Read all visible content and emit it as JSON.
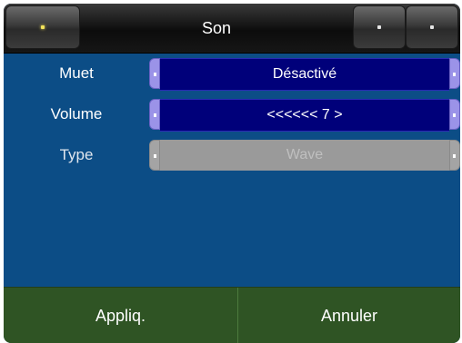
{
  "header": {
    "title": "Son"
  },
  "settings": [
    {
      "label": "Muet",
      "value": "Désactivé",
      "state": "active"
    },
    {
      "label": "Volume",
      "value": "<<<<<< 7 >",
      "state": "active"
    },
    {
      "label": "Type",
      "value": "Wave",
      "state": "disabled"
    }
  ],
  "footer": {
    "apply_label": "Appliq.",
    "cancel_label": "Annuler"
  },
  "colors": {
    "background": "#0c4d86",
    "field_active": "#00007a",
    "field_disabled": "#9a9a9a",
    "footer": "#2f5424",
    "arrow_active": "#9b93e8"
  }
}
